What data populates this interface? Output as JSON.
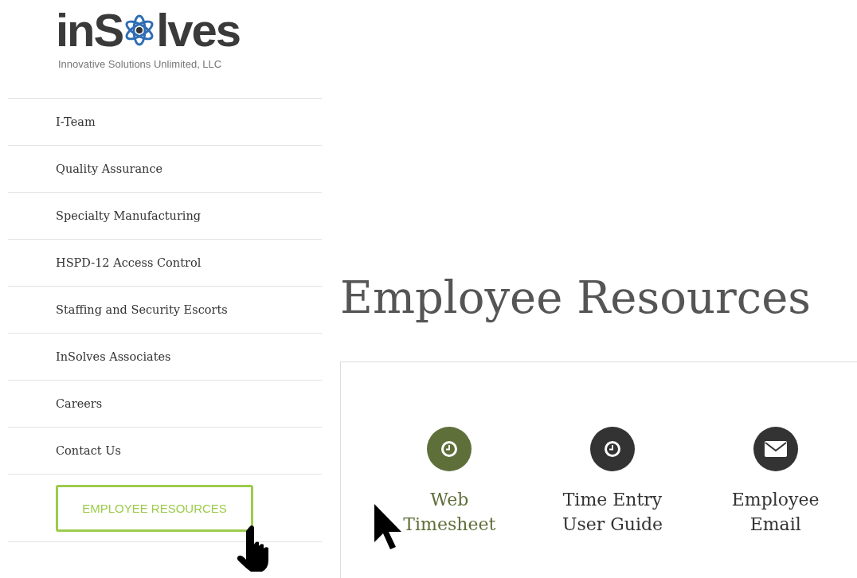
{
  "logo": {
    "text_before": "inS",
    "text_after": "lves",
    "tagline": "Innovative Solutions Unlimited, LLC"
  },
  "nav": {
    "items": [
      {
        "label": "I-Team"
      },
      {
        "label": "Quality Assurance"
      },
      {
        "label": "Specialty Manufacturing"
      },
      {
        "label": "HSPD-12 Access Control"
      },
      {
        "label": "Staffing and Security Escorts"
      },
      {
        "label": "InSolves Associates"
      },
      {
        "label": "Careers"
      },
      {
        "label": "Contact Us"
      }
    ],
    "button": {
      "label": "EMPLOYEE RESOURCES"
    }
  },
  "page_title": "Employee Resources",
  "resources": [
    {
      "label_lines": [
        "Web",
        "Timesheet"
      ],
      "kind": "clock",
      "highlighted": true
    },
    {
      "label_lines": [
        "Time Entry",
        "User Guide"
      ],
      "kind": "clock",
      "highlighted": false
    },
    {
      "label_lines": [
        "Employee",
        "Email"
      ],
      "kind": "mail",
      "highlighted": false
    }
  ]
}
